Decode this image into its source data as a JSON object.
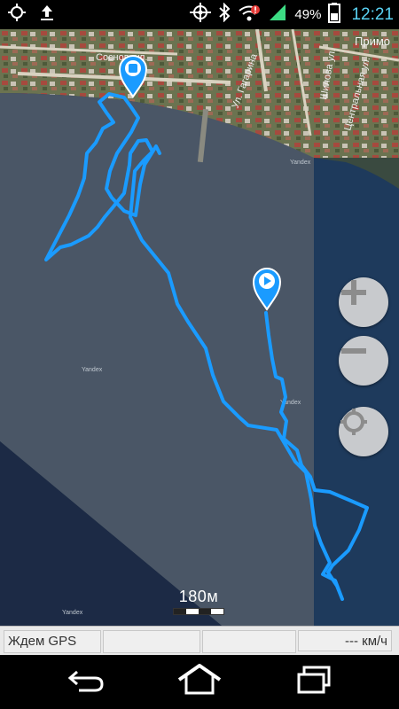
{
  "status_bar": {
    "battery_percent": "49%",
    "time": "12:21",
    "icons": [
      "gps-fix-icon",
      "upload-icon",
      "gps-target-icon",
      "bluetooth-icon",
      "wifi-alert-icon",
      "signal-icon",
      "battery-icon"
    ]
  },
  "map": {
    "watermark": "Yandex",
    "labels": [
      "Соснов. ул.",
      "Ул. Гагарина",
      "Шилова ул.",
      "Центральная ул.",
      "Примо"
    ],
    "scale_label": "180м",
    "track_color": "#1a9bff"
  },
  "zoom_controls": {
    "zoom_in_icon": "plus-icon",
    "zoom_out_icon": "minus-icon",
    "locate_icon": "locate-icon"
  },
  "info_bar": {
    "gps_status": "Ждем GPS",
    "speed": "--- км/ч"
  },
  "nav_bar": {
    "icons": [
      "back-icon",
      "home-icon",
      "recent-apps-icon"
    ]
  }
}
